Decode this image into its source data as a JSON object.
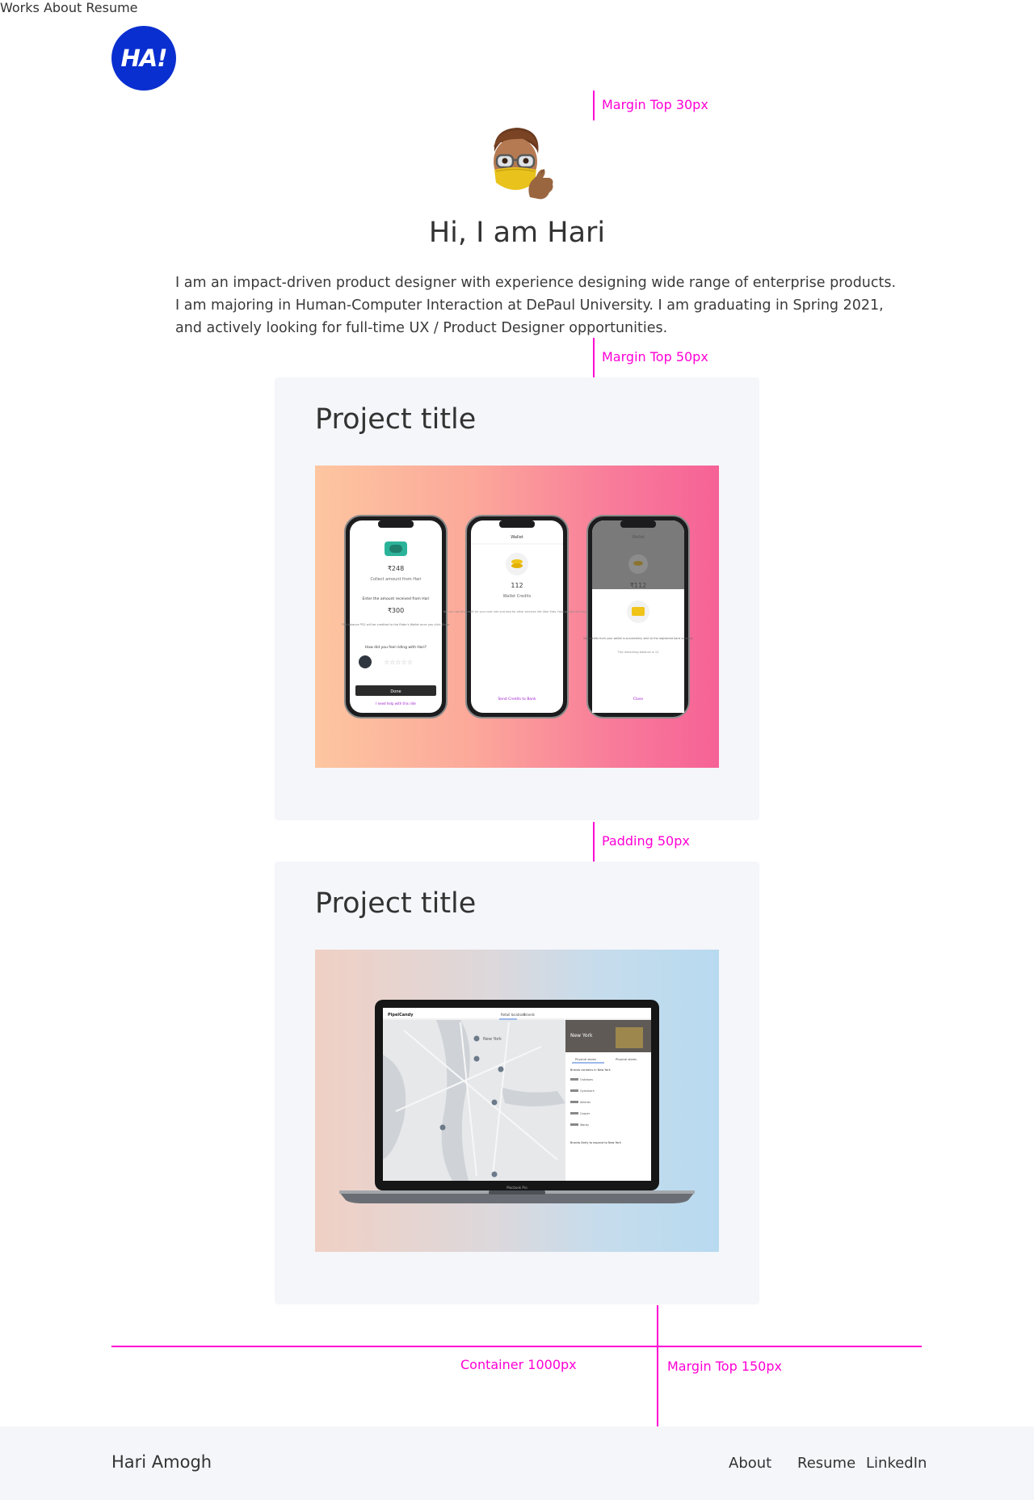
{
  "header": {
    "logo_text": "HA!",
    "nav": [
      "Works",
      "About",
      "Resume"
    ]
  },
  "hero": {
    "title": "Hi, I am Hari",
    "bio_lines": [
      "I am an impact-driven product designer with experience designing wide range of enterprise products.",
      "I am majoring in Human-Computer Interaction at DePaul University. I am graduating in Spring 2021,",
      "and actively looking for full-time UX / Product Designer opportunities."
    ]
  },
  "annotations": {
    "margin_top_30": "Margin Top 30px",
    "margin_top_50": "Margin Top 50px",
    "padding_50": "Padding 50px",
    "container_1000": "Container 1000px",
    "margin_top_150": "Margin Top 150px"
  },
  "projects": [
    {
      "title": "Project title",
      "screens": [
        {
          "amount": "₹248",
          "subtitle": "Collect amount from Hari",
          "prompt": "Enter the amount received from Hari",
          "entered": "₹300",
          "note": "The balance ₹52 will be credited to the Rider's Wallet once you click Done.",
          "rating_q": "How did you feel riding with Hari?",
          "done": "Done",
          "help": "I need help with this ride"
        },
        {
          "header": "Wallet",
          "credits": "112",
          "credits_label": "Wallet Credits",
          "desc": "You can use this credit for your next ride and also for other services like Uber Eats, food parcels and Dunzo.",
          "cta": "Send Credits to Bank"
        },
        {
          "header": "Wallet",
          "credits": "₹112",
          "msg": "100 credits from your wallet is successfully sent to the registered bank account.",
          "remaining": "The remaining balance is 12",
          "close": "Close"
        }
      ]
    },
    {
      "title": "Project title",
      "laptop": {
        "brand": "PipelCandy",
        "tabs": [
          "Retail locations",
          "Brands"
        ],
        "city_map": "New York",
        "city_panel": "New York",
        "panel_tabs": [
          "Physical stores",
          "Physical stores"
        ],
        "panel_heading": "Brands contains in New York",
        "brands": [
          "Outdoors",
          "Gymshark",
          "Allbirds",
          "Casper",
          "Warby"
        ],
        "expand_heading": "Brands likely to expand to New York",
        "device_label": "Macbook Pro"
      }
    }
  ],
  "footer": {
    "name": "Hari Amogh",
    "links": [
      "About",
      "Resume",
      "LinkedIn"
    ]
  },
  "colors": {
    "logo": "#0a2fd0",
    "annotation": "#ff00d4",
    "card_bg": "#f5f6fa",
    "text": "#333333"
  }
}
